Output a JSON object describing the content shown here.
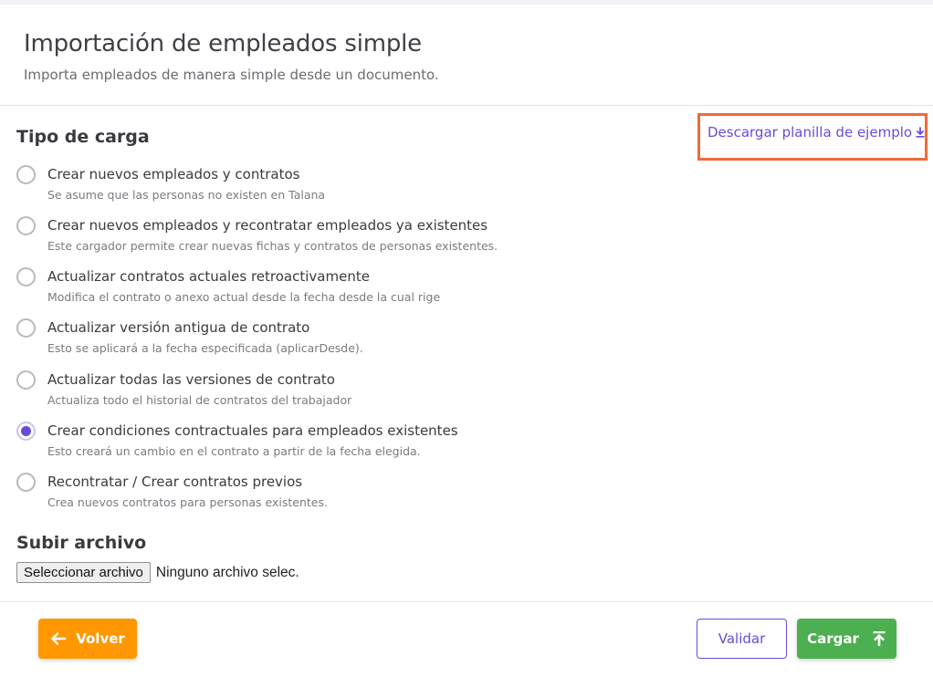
{
  "header": {
    "title": "Importación de empleados simple",
    "subtitle": "Importa empleados de manera simple desde un documento."
  },
  "load_type": {
    "title": "Tipo de carga",
    "download_link": "Descargar planilla de ejemplo",
    "selected_index": 5,
    "options": [
      {
        "label": "Crear nuevos empleados y contratos",
        "description": "Se asume que las personas no existen en Talana"
      },
      {
        "label": "Crear nuevos empleados y recontratar empleados ya existentes",
        "description": "Este cargador permite crear nuevas fichas y contratos de personas existentes."
      },
      {
        "label": "Actualizar contratos actuales retroactivamente",
        "description": "Modifica el contrato o anexo actual desde la fecha desde la cual rige"
      },
      {
        "label": "Actualizar versión antigua de contrato",
        "description": "Esto se aplicará a la fecha especificada (aplicarDesde)."
      },
      {
        "label": "Actualizar todas las versiones de contrato",
        "description": "Actualiza todo el historial de contratos del trabajador"
      },
      {
        "label": "Crear condiciones contractuales para empleados existentes",
        "description": "Esto creará un cambio en el contrato a partir de la fecha elegida."
      },
      {
        "label": "Recontratar / Crear contratos previos",
        "description": "Crea nuevos contratos para personas existentes."
      }
    ]
  },
  "upload": {
    "title": "Subir archivo",
    "button_label": "Seleccionar archivo",
    "status": "Ninguno archivo selec."
  },
  "footer": {
    "back_label": "Volver",
    "validate_label": "Validar",
    "upload_label": "Cargar"
  },
  "colors": {
    "accent": "#6a4ad8",
    "back_button": "#ff9800",
    "upload_button": "#4caf50",
    "highlight_box": "#f06b3a"
  },
  "icons": {
    "download": "download-icon",
    "back": "arrow-left-icon",
    "upload": "upload-icon"
  }
}
